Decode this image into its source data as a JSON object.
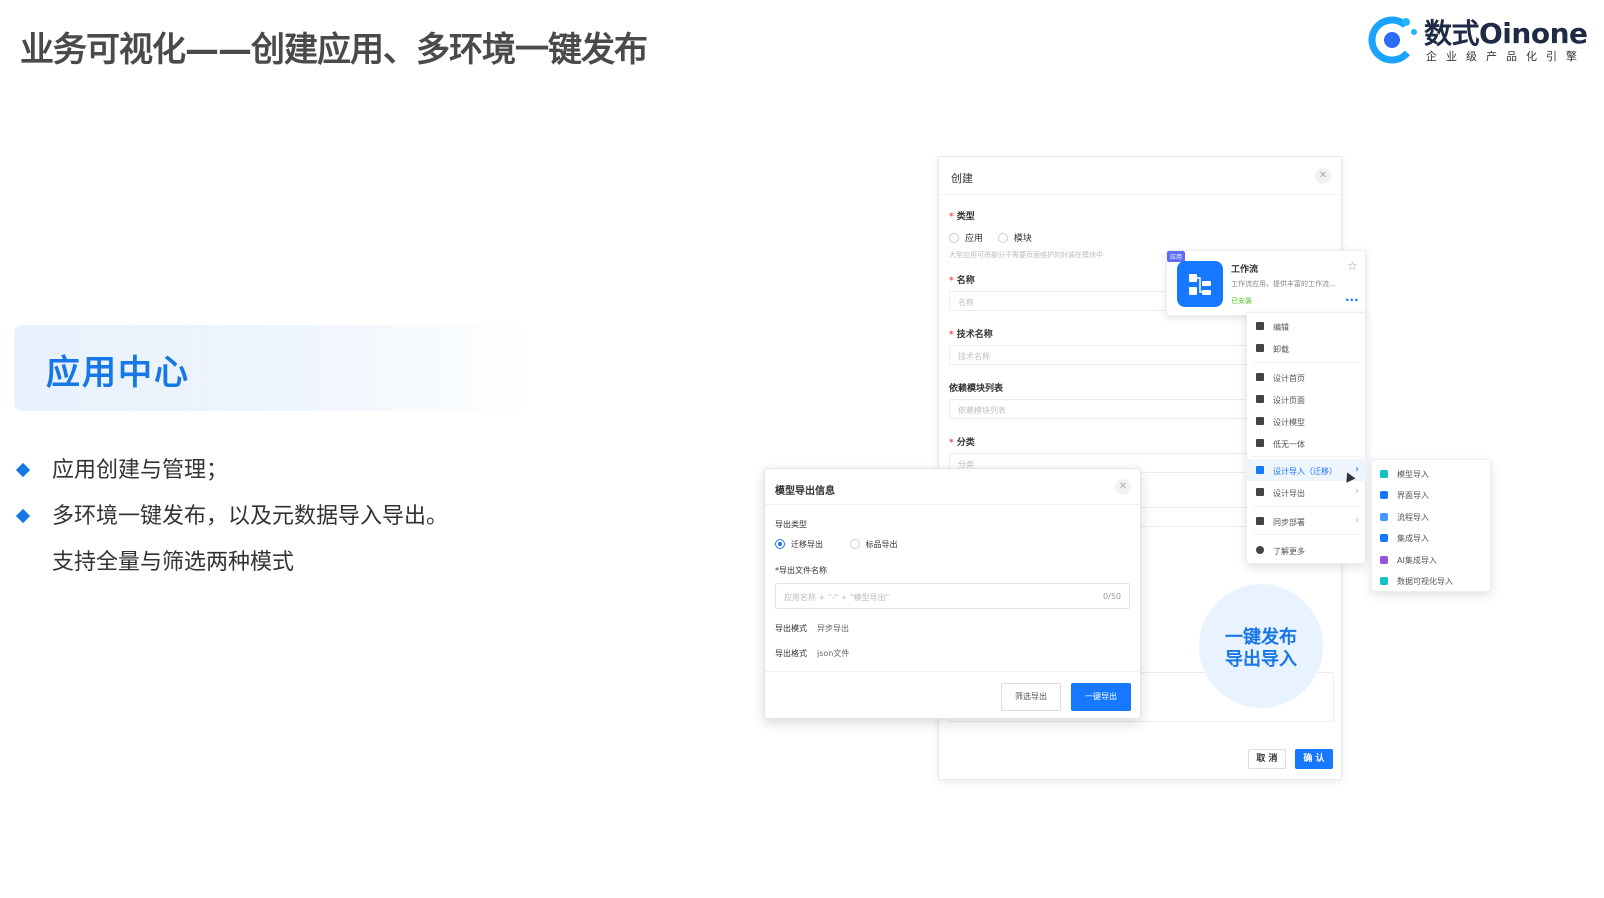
{
  "slide": {
    "title": "业务可视化——创建应用、多环境一键发布",
    "logo_brand": "数式Oinone",
    "logo_tagline": "企业级产品化引擎",
    "section_title": "应用中心",
    "bullets": [
      "应用创建与管理；",
      "多环境一键发布，以及元数据导入导出。支持全量与筛选两种模式"
    ],
    "badge_line1": "一键发布",
    "badge_line2": "导出导入"
  },
  "create_dialog": {
    "title": "创建",
    "type_label": "类型",
    "type_options": [
      "应用",
      "模块"
    ],
    "type_hint": "大型应用可将部分不需要页面维护的封装在模块中",
    "name_label": "名称",
    "name_placeholder": "名称",
    "tech_name_label": "技术名称",
    "tech_name_placeholder": "技术名称",
    "dep_label": "依赖模块列表",
    "dep_placeholder": "依赖模块列表",
    "category_label": "分类",
    "category_placeholder": "分类",
    "cancel": "取 消",
    "ok": "确 认"
  },
  "app_card": {
    "tag": "应用",
    "name": "工作流",
    "desc": "工作流应用，提供丰富的工作流...",
    "status": "已安装"
  },
  "action_menu": {
    "items": [
      "编辑",
      "卸载",
      "设计首页",
      "设计页面",
      "设计模型",
      "低无一体",
      "设计导入（迁移）",
      "设计导出",
      "同步部署",
      "了解更多"
    ]
  },
  "import_submenu": {
    "items": [
      "模型导入",
      "界面导入",
      "流程导入",
      "集成导入",
      "AI集成导入",
      "数据可视化导入"
    ]
  },
  "export_dialog": {
    "title": "模型导出信息",
    "export_type_label": "导出类型",
    "export_type_options": [
      "迁移导出",
      "标品导出"
    ],
    "file_name_label": "*导出文件名称",
    "file_name_placeholder": "应用名称 + \"-\" + \"模型导出\"",
    "file_name_count": "0/50",
    "mode_label": "导出模式",
    "mode_value": "异步导出",
    "format_label": "导出格式",
    "format_value": "json文件",
    "filter_button": "筛选导出",
    "export_button": "一键导出"
  },
  "colors": {
    "accent": "#1677e6",
    "primary_button": "#1677ff"
  }
}
